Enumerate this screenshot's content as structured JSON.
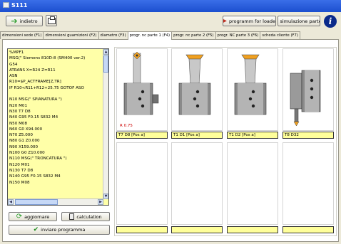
{
  "window": {
    "title": "S111"
  },
  "toolbar": {
    "back_label": "indietro",
    "loader_label": "programm for loader",
    "simulation_label": "simulazione parte 1"
  },
  "tabs": [
    {
      "label": "dimensioni sede (F1)"
    },
    {
      "label": "dimensioni guarnizioni (F2)"
    },
    {
      "label": "diametro (F3)"
    },
    {
      "label": "progr. nc parte 1 (F4)",
      "active": true
    },
    {
      "label": "progr. nc parte 2 (F5)"
    },
    {
      "label": "progr. NC parte 3 (F6)"
    },
    {
      "label": "scheda cliente (F7)"
    }
  ],
  "program": {
    "lines": [
      "%MPF1",
      "MSG(\" Siemens 810D-8 (SM400 ver.2)",
      "G54",
      "ATRANS X=R24 Z=R11",
      "ASN",
      "R10=$P_ACTFRAME[Z,TR]",
      "IF R10<R11+R12+25.75 GOTOF ASO",
      "",
      "N10 MSG(\" SPIANATURA \")",
      "N20 M01",
      "N30 T7 D8",
      "N40 G95 F0.15 S832 M4",
      "N50 M08",
      "N60  G0  X94.000",
      "N70  Z5.000",
      "N80  G1  Z0.000",
      "N90  X159.000",
      "N100  G0  Z10.000",
      "N110 MSG(\" TRONCATURA \")",
      "N120 M01",
      "N130 T7 D8",
      "N140 G95 F0.15 S832 M4",
      "N150 M08"
    ]
  },
  "buttons": {
    "update_label": "aggiornare",
    "calculation_label": "calculation",
    "send_label": "inviare programma"
  },
  "tools": [
    {
      "label": "T7 D8  [Pos a]",
      "annotation": "R 0.75",
      "kind": "turning"
    },
    {
      "label": "T1 D1  [Pos a]",
      "kind": "insert"
    },
    {
      "label": "T1 D2  [Pos a]",
      "kind": "insert"
    },
    {
      "label": "T8 D32",
      "kind": "boring"
    },
    {
      "label": ""
    },
    {
      "label": ""
    },
    {
      "label": ""
    },
    {
      "label": ""
    }
  ],
  "colors": {
    "title_bar": "#2456d8",
    "code_background": "#ffffa8",
    "label_background": "#ffff9a",
    "insert_orange": "#f0a020",
    "annotation_red": "#cc0000"
  }
}
